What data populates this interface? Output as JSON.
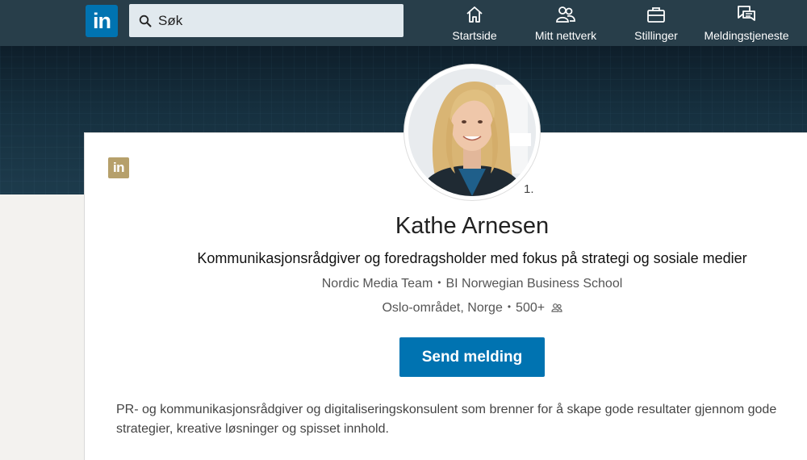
{
  "nav": {
    "logo_text": "in",
    "search_placeholder": "Søk",
    "items": [
      {
        "label": "Startside",
        "icon": "home-icon"
      },
      {
        "label": "Mitt nettverk",
        "icon": "network-icon"
      },
      {
        "label": "Stillinger",
        "icon": "briefcase-icon"
      },
      {
        "label": "Meldingstjeneste",
        "icon": "messaging-icon"
      }
    ]
  },
  "profile": {
    "badge_text": "in",
    "degree": "1.",
    "name": "Kathe Arnesen",
    "headline": "Kommunikasjonsrådgiver og foredragsholder med fokus på strategi og sosiale medier",
    "company": "Nordic Media Team",
    "school": "BI Norwegian Business School",
    "location": "Oslo-området, Norge",
    "connections": "500+",
    "send_button": "Send melding",
    "summary_line1": "PR- og kommunikasjonsrådgiver og digitaliseringskonsulent som brenner for å skape gode resultater gjennom gode",
    "summary_line2": "strategier, kreative løsninger og spisset innhold."
  },
  "colors": {
    "nav_bg": "#283e4a",
    "brand_blue": "#0073b1",
    "premium_gold": "#b6a06b"
  }
}
